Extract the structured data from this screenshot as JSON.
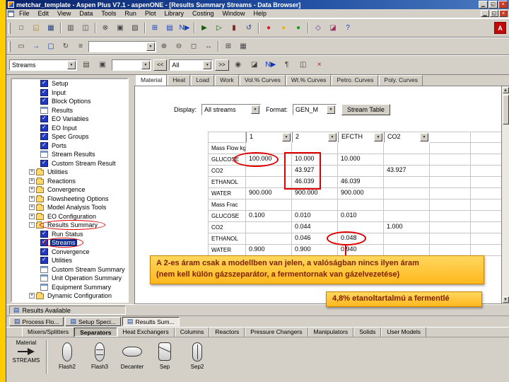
{
  "window": {
    "title": "metchar_template - Aspen Plus V7.1 - aspenONE - [Results Summary Streams - Data Browser]",
    "controls": [
      {
        "name": "minimize-button",
        "glyph": "▁"
      },
      {
        "name": "restore-button",
        "glyph": "◱"
      },
      {
        "name": "close-button",
        "glyph": "×"
      }
    ]
  },
  "menubar": {
    "items": [
      "File",
      "Edit",
      "View",
      "Data",
      "Tools",
      "Run",
      "Plot",
      "Library",
      "Costing",
      "Window",
      "Help"
    ],
    "child_controls": [
      {
        "name": "child-minimize-button",
        "glyph": "▁"
      },
      {
        "name": "child-restore-button",
        "glyph": "◱"
      },
      {
        "name": "child-close-button",
        "glyph": "×"
      }
    ]
  },
  "toolbar_main": {
    "buttons": [
      {
        "name": "new-icon",
        "glyph": "□"
      },
      {
        "name": "open-icon",
        "glyph": "◱",
        "color": "#b08020"
      },
      {
        "name": "save-icon",
        "glyph": "▦",
        "color": "#204080"
      },
      {
        "name": "sep"
      },
      {
        "name": "print-icon",
        "glyph": "▥"
      },
      {
        "name": "print-preview-icon",
        "glyph": "◫"
      },
      {
        "name": "sep"
      },
      {
        "name": "cut-icon",
        "glyph": "⊗"
      },
      {
        "name": "copy-icon",
        "glyph": "▣"
      },
      {
        "name": "paste-icon",
        "glyph": "▧"
      },
      {
        "name": "sep"
      },
      {
        "name": "data-browser-icon",
        "glyph": "⊞",
        "color": "#1040c0"
      },
      {
        "name": "control-panel-icon",
        "glyph": "▤",
        "color": "#1040c0"
      },
      {
        "name": "next-input-icon",
        "glyph": "N▶",
        "color": "#1040c0"
      },
      {
        "name": "sep"
      },
      {
        "name": "run-icon",
        "glyph": "▶",
        "color": "#106010"
      },
      {
        "name": "step-icon",
        "glyph": "▷",
        "color": "#106010"
      },
      {
        "name": "pause-icon",
        "glyph": "▮",
        "color": "#802020"
      },
      {
        "name": "reinitialize-icon",
        "glyph": "↺",
        "color": "#204080"
      },
      {
        "name": "sep"
      },
      {
        "name": "stop-light-icon",
        "glyph": "●",
        "color": "#d42020"
      },
      {
        "name": "caution-light-icon",
        "glyph": "●",
        "color": "#e8b800"
      },
      {
        "name": "go-light-icon",
        "glyph": "●",
        "color": "#18a018"
      },
      {
        "name": "sep"
      },
      {
        "name": "flowsheet-icon",
        "glyph": "◇",
        "color": "#6030a0"
      },
      {
        "name": "plot-icon",
        "glyph": "◪",
        "color": "#a03060"
      },
      {
        "name": "help-icon",
        "glyph": "?",
        "color": "#1040c0"
      }
    ]
  },
  "toolbar_flowsheet": {
    "buttons_left": [
      {
        "name": "flowsheet-window-icon",
        "glyph": "▭"
      },
      {
        "name": "insert-stream-icon",
        "glyph": "→",
        "color": "#1040c0"
      },
      {
        "name": "insert-block-icon",
        "glyph": "▢",
        "color": "#1040c0"
      },
      {
        "name": "rotate-icon",
        "glyph": "↻"
      },
      {
        "name": "align-icon",
        "glyph": "≡"
      }
    ],
    "combo_value": "",
    "buttons_right": [
      {
        "name": "zoom-in-icon",
        "glyph": "⊕"
      },
      {
        "name": "zoom-out-icon",
        "glyph": "⊖"
      },
      {
        "name": "zoom-full-icon",
        "glyph": "◻"
      },
      {
        "name": "pan-icon",
        "glyph": "↔"
      },
      {
        "name": "sep"
      },
      {
        "name": "grid-icon",
        "glyph": "⊞"
      },
      {
        "name": "section-icon",
        "glyph": "▦"
      }
    ]
  },
  "data_browser": {
    "toolbar": {
      "node_combo": "Streams",
      "units_combo": "",
      "nav_prev": "<<",
      "stream_filter": "All",
      "nav_next": ">>",
      "buttons_mid": [
        {
          "name": "sheet-icon",
          "glyph": "▤"
        },
        {
          "name": "forms-stack-icon",
          "glyph": "▣"
        }
      ],
      "buttons_right": [
        {
          "name": "snapshot-icon",
          "glyph": "◉"
        },
        {
          "name": "chart-icon",
          "glyph": "◪"
        },
        {
          "name": "next-input-icon",
          "glyph": "N▶",
          "color": "#1030c0"
        },
        {
          "name": "comments-icon",
          "glyph": "¶"
        },
        {
          "name": "compare-icon",
          "glyph": "◫"
        },
        {
          "name": "close-view-icon",
          "glyph": "×",
          "color": "#a02020"
        }
      ]
    },
    "tree": {
      "items": [
        {
          "label": "Setup",
          "icon": "check",
          "indent": 2
        },
        {
          "label": "Input",
          "icon": "check",
          "indent": 2
        },
        {
          "label": "Block Options",
          "icon": "check",
          "indent": 2
        },
        {
          "label": "Results",
          "icon": "sheet",
          "indent": 2
        },
        {
          "label": "EO Variables",
          "icon": "check",
          "indent": 2
        },
        {
          "label": "EO Input",
          "icon": "check",
          "indent": 2
        },
        {
          "label": "Spec Groups",
          "icon": "check",
          "indent": 2
        },
        {
          "label": "Ports",
          "icon": "check",
          "indent": 2
        },
        {
          "label": "Stream Results",
          "icon": "sheet",
          "indent": 2
        },
        {
          "label": "Custom Stream Result",
          "icon": "check",
          "indent": 2
        },
        {
          "label": "Utilities",
          "icon": "folder",
          "indent": 1,
          "expand": "plus"
        },
        {
          "label": "Reactions",
          "icon": "folder",
          "indent": 1,
          "expand": "plus"
        },
        {
          "label": "Convergence",
          "icon": "folder",
          "indent": 1,
          "expand": "plus"
        },
        {
          "label": "Flowsheeting Options",
          "icon": "folder",
          "indent": 1,
          "expand": "plus"
        },
        {
          "label": "Model Analysis Tools",
          "icon": "folder",
          "indent": 1,
          "expand": "plus"
        },
        {
          "label": "EO Configuration",
          "icon": "folder",
          "indent": 1,
          "expand": "plus"
        },
        {
          "label": "Results Summary",
          "icon": "folder",
          "indent": 1,
          "expand": "minus",
          "circled": true
        },
        {
          "label": "Run Status",
          "icon": "check",
          "indent": 2
        },
        {
          "label": "Streams",
          "icon": "check",
          "indent": 2,
          "selected": true,
          "circled": true
        },
        {
          "label": "Convergence",
          "icon": "check",
          "indent": 2
        },
        {
          "label": "Utilities",
          "icon": "check",
          "indent": 2
        },
        {
          "label": "Custom Stream Summary",
          "icon": "sheet",
          "indent": 2
        },
        {
          "label": "Unit Operation Summary",
          "icon": "sheet",
          "indent": 2
        },
        {
          "label": "Equipment Summary",
          "icon": "sheet",
          "indent": 2
        },
        {
          "label": "Dynamic Configuration",
          "icon": "folder",
          "indent": 1,
          "expand": "plus"
        }
      ]
    },
    "tabs": [
      {
        "label": "Material",
        "active": true
      },
      {
        "label": "Heat"
      },
      {
        "label": "Load"
      },
      {
        "label": "Work"
      },
      {
        "label": "Vol.% Curves"
      },
      {
        "label": "Wt.% Curves"
      },
      {
        "label": "Petro. Curves"
      },
      {
        "label": "Poly. Curves"
      }
    ],
    "display": {
      "label": "Display:",
      "value": "All streams",
      "format_label": "Format:",
      "format_value": "GEN_M",
      "button": "Stream Table"
    },
    "table": {
      "columns": [
        "",
        "1",
        "2",
        "EFCTH",
        "CO2",
        "",
        ""
      ],
      "rows": [
        {
          "label": "Mass Flow kg/hr",
          "values": [
            "",
            "",
            "",
            "",
            "",
            ""
          ]
        },
        {
          "label": "GLUCOSE",
          "values": [
            "100.000",
            "10.000",
            "10.000",
            "",
            "",
            ""
          ]
        },
        {
          "label": "CO2",
          "values": [
            "",
            "43.927",
            "",
            "43.927",
            "",
            ""
          ]
        },
        {
          "label": "ETHANOL",
          "values": [
            "",
            "46.039",
            "46.039",
            "",
            "",
            ""
          ]
        },
        {
          "label": "WATER",
          "values": [
            "900.000",
            "900.000",
            "900.000",
            "",
            "",
            ""
          ]
        },
        {
          "label": "Mass Frac",
          "values": [
            "",
            "",
            "",
            "",
            "",
            ""
          ]
        },
        {
          "label": "GLUCOSE",
          "values": [
            "0.100",
            "0.010",
            "0.010",
            "",
            "",
            ""
          ]
        },
        {
          "label": "CO2",
          "values": [
            "",
            "0.044",
            "",
            "1.000",
            "",
            ""
          ]
        },
        {
          "label": "ETHANOL",
          "values": [
            "",
            "0.046",
            "0.048",
            "",
            "",
            ""
          ]
        },
        {
          "label": "WATER",
          "values": [
            "0.900",
            "0.900",
            "0.940",
            "",
            "",
            ""
          ]
        }
      ]
    }
  },
  "annotations": {
    "note_main_line1": "A 2-es áram csak a modellben van jelen, a valóságban nincs ilyen áram",
    "note_main_line2": "(nem kell külön gázszeparátor, a fermentornak van gázelvezetése)",
    "note_ethanol": "4,8% etanoltartalmú a fermentlé"
  },
  "statusbar": {
    "icon_glyph": "▤",
    "text": "Results Available"
  },
  "workspace_tabs": [
    {
      "label": "Process Flo...",
      "glyph": "▤"
    },
    {
      "label": "Setup Speci...",
      "glyph": "▤"
    },
    {
      "label": "Results Sum...",
      "glyph": "▤",
      "active": true
    }
  ],
  "model_library": {
    "tabs": [
      {
        "label": "Mixers/Splitters"
      },
      {
        "label": "Separators",
        "active": true
      },
      {
        "label": "Heat Exchangers"
      },
      {
        "label": "Columns"
      },
      {
        "label": "Reactors"
      },
      {
        "label": "Pressure Changers"
      },
      {
        "label": "Manipulators"
      },
      {
        "label": "Solids"
      },
      {
        "label": "User Models"
      }
    ],
    "stream_section": {
      "title": "Material",
      "name": "STREAMS"
    },
    "models": [
      {
        "label": "Flash2",
        "shape": "flash2"
      },
      {
        "label": "Flash3",
        "shape": "flash3"
      },
      {
        "label": "Decanter",
        "shape": "decanter"
      },
      {
        "label": "Sep",
        "shape": "sep"
      },
      {
        "label": "Sep2",
        "shape": "sep2"
      }
    ]
  }
}
